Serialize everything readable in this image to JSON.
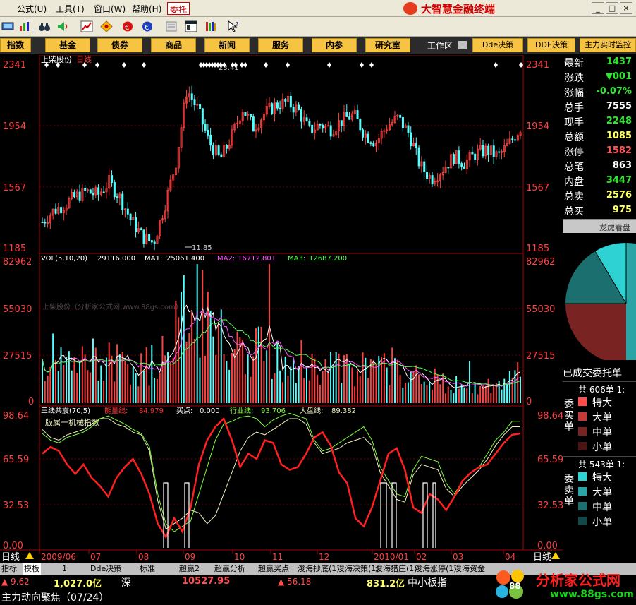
{
  "menu": {
    "items": [
      {
        "label": "公式(U)"
      },
      {
        "label": "工具(T)"
      },
      {
        "label": "窗口(W)"
      },
      {
        "label": "帮助(H)"
      }
    ],
    "active": "委托"
  },
  "brand": {
    "title": "大智慧金融终端"
  },
  "window_controls": [
    "_",
    "□",
    "×"
  ],
  "nav": {
    "buttons": [
      "指数",
      "基金",
      "债券",
      "商品",
      "新闻",
      "服务",
      "内参",
      "研究室"
    ],
    "workarea": "工作区",
    "right_buttons": [
      "Dde决策",
      "DDE决策",
      "主力实时监控"
    ]
  },
  "chart": {
    "stock_name": "上柴股份",
    "period": "日线",
    "price_axis": [
      "2341",
      "1954",
      "1567",
      "1185"
    ],
    "high_mark": "23.41",
    "low_mark": "11.85",
    "vol_header": {
      "name": "VOL(5,10,20)",
      "value": "29116.000",
      "ma1_label": "MA1:",
      "ma1": "25061.400",
      "ma2_label": "MA2:",
      "ma2": "16712.801",
      "ma3_label": "MA3:",
      "ma3": "12687.200"
    },
    "vol_axis": [
      "82962",
      "55030",
      "27515",
      "0"
    ],
    "vol_watermark": "上柴股份（分析家公式网 www.88gs.com）",
    "ind_header": {
      "name": "三线共震(70,5)",
      "energy_label": "能量线:",
      "energy": "84.979",
      "buy_label": "买点:",
      "buy": "0.000",
      "industry_label": "行业线:",
      "industry": "93.706",
      "market_label": "大盘线:",
      "market": "89.382"
    },
    "ind_sublabel": "版属一机械指数",
    "ind_axis": [
      "98.64",
      "65.59",
      "32.53",
      "0.00"
    ],
    "date_ticks": [
      "2009/06",
      "07",
      "08",
      "09",
      "10",
      "11",
      "12",
      "2010/01",
      "02",
      "03",
      "04"
    ],
    "period_label": "日线"
  },
  "chart_data": [
    {
      "type": "candlestick",
      "title": "上柴股份 日线",
      "ylim": [
        11.85,
        23.41
      ],
      "y_ticks": [
        23.41,
        19.54,
        15.67,
        11.85
      ],
      "x_ticks": [
        "2009/06",
        "07",
        "08",
        "09",
        "10",
        "11",
        "12",
        "2010/01",
        "02",
        "03",
        "04"
      ],
      "markers": {
        "high": 23.41,
        "low": 11.85
      },
      "close_trend": [
        13.5,
        14.2,
        14.6,
        15.1,
        15.4,
        15.2,
        16.0,
        15.0,
        13.6,
        12.6,
        12.2,
        14.5,
        17.2,
        21.8,
        20.5,
        18.5,
        17.4,
        18.8,
        20.6,
        19.4,
        20.3,
        20.8,
        21.0,
        20.5,
        19.2,
        19.6,
        19.3,
        19.9,
        20.2,
        19.0,
        18.5,
        19.5,
        20.0,
        19.0,
        17.0,
        16.2,
        16.8,
        17.6,
        17.2,
        17.8,
        18.0,
        17.6,
        18.4,
        19.4
      ]
    },
    {
      "type": "bar",
      "title": "VOL(5,10,20)",
      "ylim": [
        0,
        82962
      ],
      "y_ticks": [
        82962,
        55030,
        27515,
        0
      ],
      "series": [
        {
          "name": "MA1",
          "last": 25061.4
        },
        {
          "name": "MA2",
          "last": 16712.801
        },
        {
          "name": "MA3",
          "last": 12687.2
        }
      ],
      "last_value": 29116.0,
      "volume_trend": [
        24000,
        30000,
        26000,
        22000,
        28000,
        30000,
        26000,
        24000,
        22000,
        22000,
        26000,
        34000,
        48000,
        70000,
        62000,
        48000,
        40000,
        38000,
        36000,
        34000,
        32000,
        30000,
        30000,
        28000,
        26000,
        24000,
        24000,
        22000,
        20000,
        22000,
        20000,
        24000,
        22000,
        20000,
        18000,
        16000,
        14000,
        12000,
        10000,
        10000,
        10000,
        12000,
        14000,
        22000
      ]
    },
    {
      "type": "line",
      "title": "三线共震(70,5)",
      "ylim": [
        0,
        98.64
      ],
      "y_ticks": [
        98.64,
        65.59,
        32.53,
        0.0
      ],
      "series": [
        {
          "name": "能量线",
          "last": 84.979,
          "color": "#ff2020"
        },
        {
          "name": "行业线",
          "last": 93.706,
          "color": "#7dfc3c"
        },
        {
          "name": "大盘线",
          "last": 89.382,
          "color": "#f0f0c0"
        },
        {
          "name": "买点",
          "last": 0.0,
          "color": "#ffffff"
        }
      ]
    },
    {
      "type": "pie",
      "title": "龙虎看盘",
      "slices": [
        {
          "name": "特大",
          "color": "#2fd2d2"
        },
        {
          "name": "大单",
          "color": "#2aa4a4"
        },
        {
          "name": "中单",
          "color": "#1c6f6f"
        },
        {
          "name": "小单",
          "color": "#7a2323"
        }
      ]
    }
  ],
  "quote": {
    "rows": [
      {
        "label": "最新",
        "value": "1437",
        "color": "#2ee62e"
      },
      {
        "label": "涨跌",
        "value": "▼001",
        "color": "#2ee62e"
      },
      {
        "label": "涨幅",
        "value": "-0.07%",
        "color": "#2ee62e"
      },
      {
        "label": "总手",
        "value": "7555",
        "color": "#ffffff"
      },
      {
        "label": "现手",
        "value": "2248",
        "color": "#2ee62e"
      },
      {
        "label": "总额",
        "value": "1085",
        "color": "#ffff66"
      },
      {
        "label": "涨停",
        "value": "1582",
        "color": "#ff5555"
      },
      {
        "label": "总笔",
        "value": "863",
        "color": "#ffffff"
      },
      {
        "label": "内盘",
        "value": "3447",
        "color": "#2ee62e"
      },
      {
        "label": "总卖",
        "value": "2576",
        "color": "#ffff66"
      },
      {
        "label": "总买",
        "value": "975",
        "color": "#ffff66"
      }
    ],
    "panel_title": "龙虎看盘",
    "done_orders": "已成交委托单",
    "buy": {
      "label": "委买单",
      "total": "共 606单 1:",
      "items": [
        "特大",
        "大单",
        "中单",
        "小单"
      ]
    },
    "sell": {
      "label": "委卖单",
      "total": "共 543单 1:",
      "items": [
        "特大",
        "大单",
        "中单",
        "小单"
      ]
    }
  },
  "tabs": [
    "指标",
    "模板",
    "1",
    "Dde决策",
    "标准",
    "超赢2",
    "超赢分析",
    "超赢买点",
    "浚海抄底(1)",
    "浚海决策(1)",
    "浚海猎庄(1)",
    "浚海涨停(1)",
    "浚海资金"
  ],
  "status": {
    "sh_change": "▲ 9.62",
    "sh_amount": "1,027.0亿",
    "sz_label": "深",
    "sz_index": "10527.95",
    "sz_change": "▲ 56.18",
    "sz_amount": "831.2亿",
    "sme_label": "中小板指",
    "focus": "主力动向聚焦（07/24）"
  },
  "watermark": {
    "title": "分析家公式网",
    "url": "www.88gs.com"
  }
}
